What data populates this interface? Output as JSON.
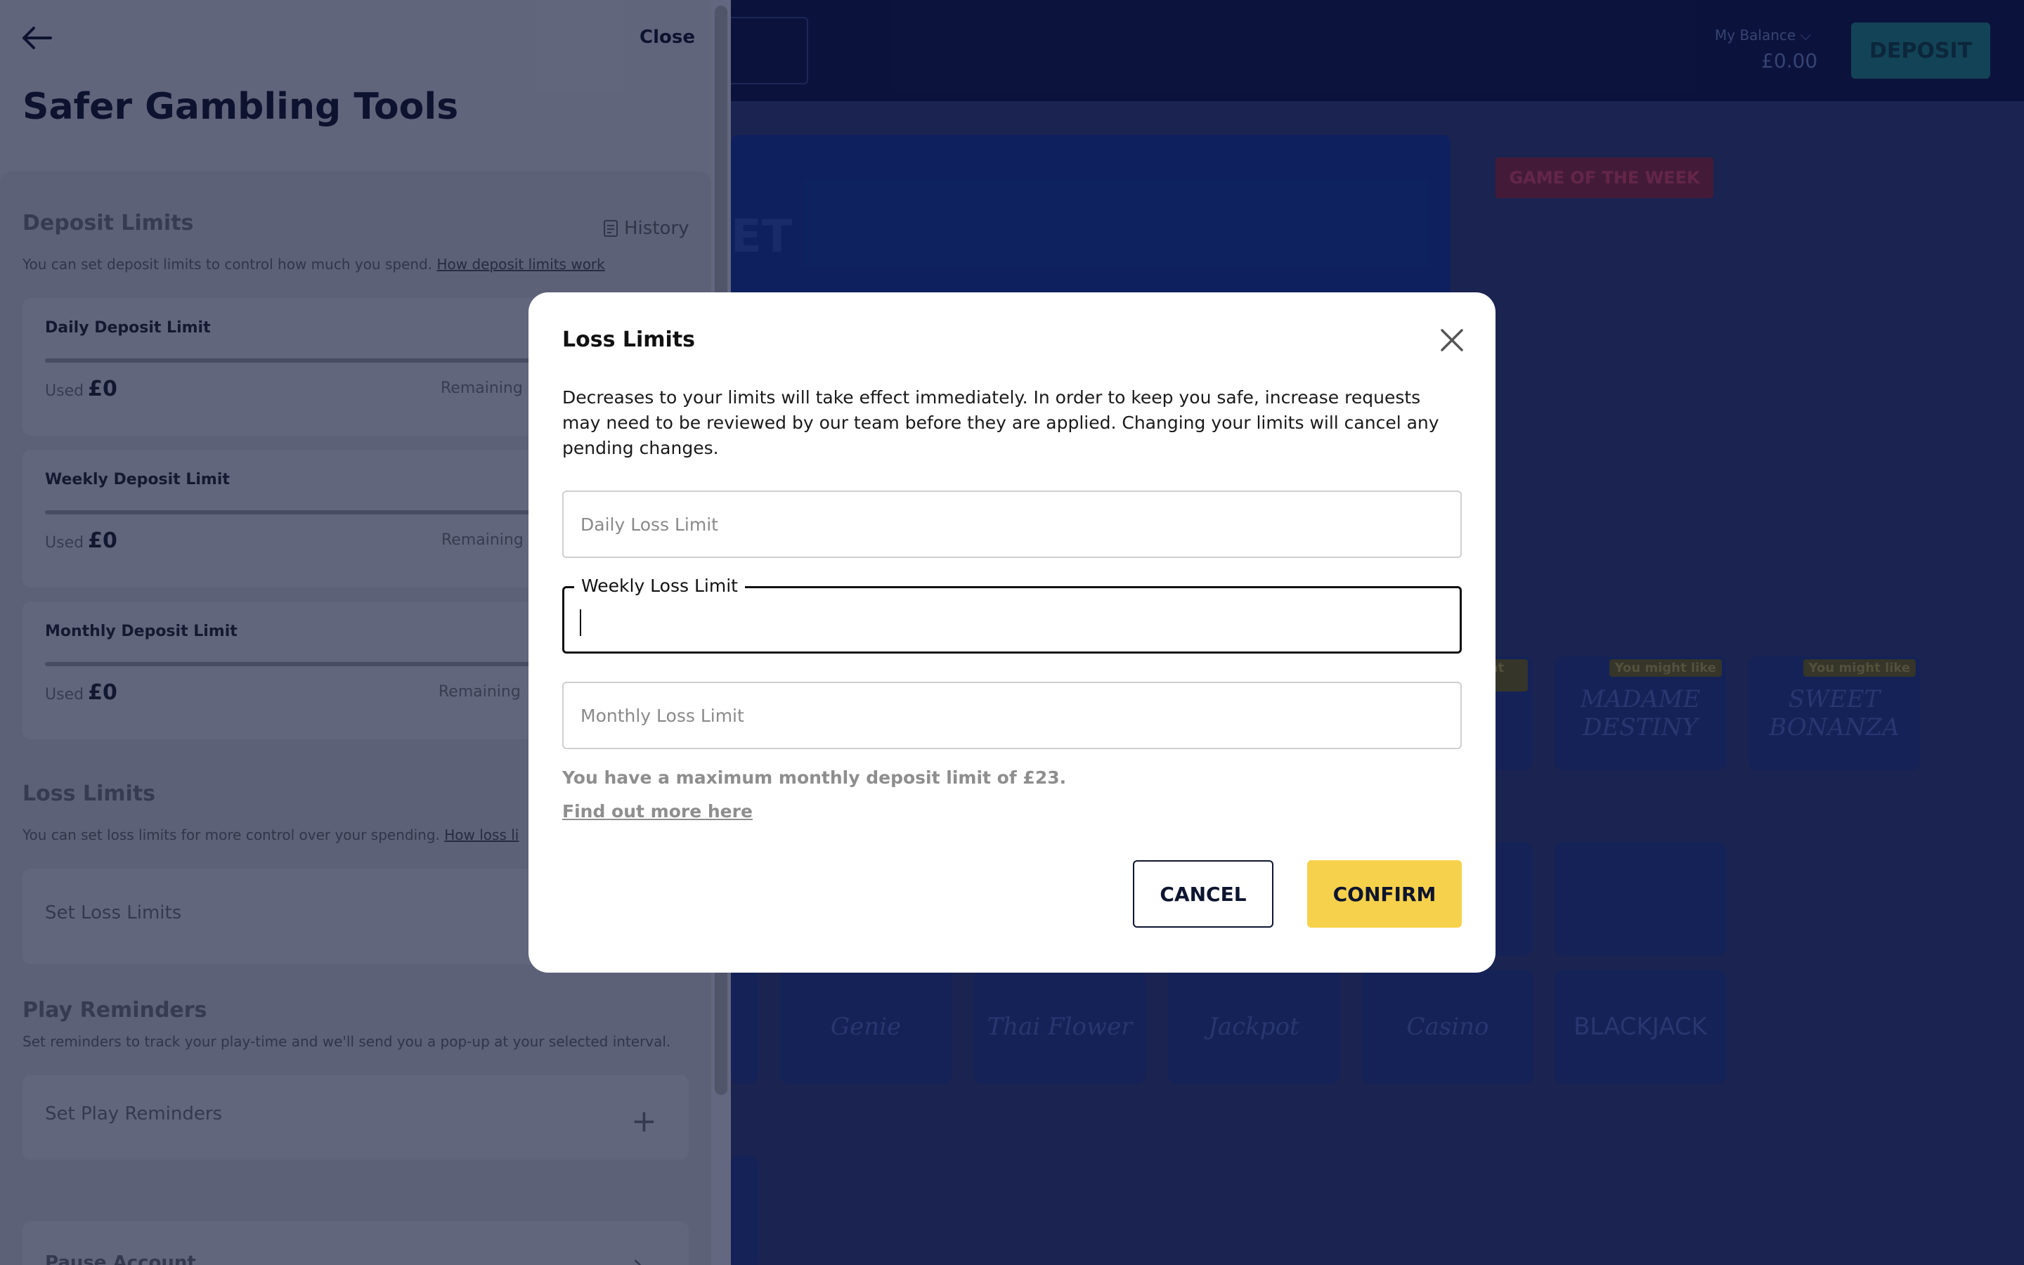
{
  "background": {
    "balance_label": "My Balance",
    "balance_value": "£0.00",
    "deposit_button": "DEPOSIT",
    "banner_text": "ET",
    "game_of_week_badge": "GAME OF THE WEEK",
    "tile_badge": "You might like",
    "tiles": [
      "MADAME DESTINY",
      "SWEET BONANZA",
      "Genie",
      "Thai Flower",
      "Jackpot",
      "Casino",
      "BLACKJACK"
    ]
  },
  "drawer": {
    "close_label": "Close",
    "title": "Safer Gambling Tools",
    "deposit_limits": {
      "heading": "Deposit Limits",
      "history_label": "History",
      "description": "You can set deposit limits to control how much you spend.",
      "link": "How deposit limits work",
      "cards": [
        {
          "title": "Daily Deposit Limit",
          "used_label": "Used",
          "used_value": "£0",
          "remaining_label": "Remaining"
        },
        {
          "title": "Weekly Deposit Limit",
          "used_label": "Used",
          "used_value": "£0",
          "remaining_label": "Remaining"
        },
        {
          "title": "Monthly Deposit Limit",
          "used_label": "Used",
          "used_value": "£0",
          "remaining_label": "Remaining"
        }
      ]
    },
    "loss_limits": {
      "heading": "Loss Limits",
      "description": "You can set loss limits for more control over your spending.",
      "link": "How loss li",
      "set_label": "Set Loss Limits"
    },
    "play_reminders": {
      "heading": "Play Reminders",
      "description": "Set reminders to track your play-time and we'll send you a pop-up at your selected interval.",
      "set_label": "Set Play Reminders"
    },
    "pause_account": {
      "label": "Pause Account"
    }
  },
  "modal": {
    "title": "Loss Limits",
    "body": "Decreases to your limits will take effect immediately. In order to keep you safe, increase requests may need to be reviewed by our team before they are applied. Changing your limits will cancel any pending changes.",
    "daily_placeholder": "Daily Loss Limit",
    "weekly_label": "Weekly Loss Limit",
    "weekly_value": "",
    "monthly_placeholder": "Monthly Loss Limit",
    "info_text": "You have a maximum monthly deposit limit of £23.",
    "info_link": "Find out more here",
    "cancel_label": "CANCEL",
    "confirm_label": "CONFIRM"
  },
  "colors": {
    "accent_yellow": "#f6d14b",
    "navy": "#0e1530",
    "drawer_bg": "#6b7086"
  }
}
